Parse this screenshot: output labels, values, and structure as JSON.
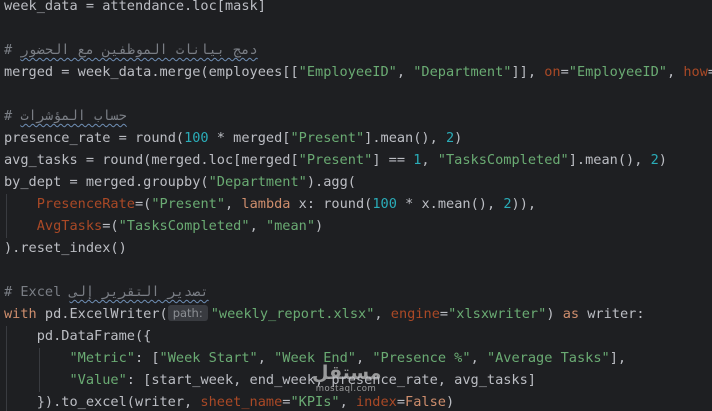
{
  "colors": {
    "background": "#1e1f22",
    "default_text": "#bcbec4",
    "keyword": "#cf8e6d",
    "string": "#6aab73",
    "number": "#2aacb8",
    "comment": "#7a7e85",
    "named_argument": "#aa4926",
    "hint_background": "#393b40"
  },
  "code": {
    "lines": [
      [
        [
          "default",
          "week_data = attendance.loc[mask]"
        ]
      ],
      [],
      [
        [
          "cmt",
          "# "
        ],
        [
          "cmt",
          "دمج بيانات الموظفين مع الحضور",
          "squig"
        ]
      ],
      [
        [
          "default",
          "merged = week_data.merge(employees[["
        ],
        [
          "str",
          "\"EmployeeID\""
        ],
        [
          "default",
          ", "
        ],
        [
          "str",
          "\"Department\""
        ],
        [
          "default",
          "]], "
        ],
        [
          "param",
          "on"
        ],
        [
          "default",
          "="
        ],
        [
          "str",
          "\"EmployeeID\""
        ],
        [
          "default",
          ", "
        ],
        [
          "param",
          "how"
        ],
        [
          "default",
          "="
        ],
        [
          "str",
          "\"l"
        ]
      ],
      [],
      [
        [
          "cmt",
          "# "
        ],
        [
          "cmt",
          "حساب المؤشرات",
          "squig"
        ]
      ],
      [
        [
          "default",
          "presence_rate = "
        ],
        [
          "default",
          "round"
        ],
        [
          "default",
          "("
        ],
        [
          "num",
          "100"
        ],
        [
          "default",
          " * merged["
        ],
        [
          "str",
          "\"Present\""
        ],
        [
          "default",
          "].mean(), "
        ],
        [
          "num",
          "2"
        ],
        [
          "default",
          ")"
        ]
      ],
      [
        [
          "default",
          "avg_tasks = "
        ],
        [
          "default",
          "round"
        ],
        [
          "default",
          "(merged.loc[merged["
        ],
        [
          "str",
          "\"Present\""
        ],
        [
          "default",
          "] == "
        ],
        [
          "num",
          "1"
        ],
        [
          "default",
          ", "
        ],
        [
          "str",
          "\"TasksCompleted\""
        ],
        [
          "default",
          "].mean(), "
        ],
        [
          "num",
          "2"
        ],
        [
          "default",
          ")"
        ]
      ],
      [
        [
          "default",
          "by_dept = merged.groupby("
        ],
        [
          "str",
          "\"Department\""
        ],
        [
          "default",
          ").agg("
        ]
      ],
      [
        [
          "default",
          "    "
        ],
        [
          "param",
          "PresenceRate"
        ],
        [
          "default",
          "=("
        ],
        [
          "str",
          "\"Present\""
        ],
        [
          "default",
          ", "
        ],
        [
          "kw",
          "lambda"
        ],
        [
          "default",
          " x: "
        ],
        [
          "default",
          "round"
        ],
        [
          "default",
          "("
        ],
        [
          "num",
          "100"
        ],
        [
          "default",
          " * x.mean(), "
        ],
        [
          "num",
          "2"
        ],
        [
          "default",
          ")),"
        ]
      ],
      [
        [
          "default",
          "    "
        ],
        [
          "param",
          "AvgTasks"
        ],
        [
          "default",
          "=("
        ],
        [
          "str",
          "\"TasksCompleted\""
        ],
        [
          "default",
          ", "
        ],
        [
          "str",
          "\"mean\""
        ],
        [
          "default",
          ")"
        ]
      ],
      [
        [
          "default",
          ").reset_index()"
        ]
      ],
      [],
      [
        [
          "cmt",
          "# Excel "
        ],
        [
          "cmt",
          "تصدير التقرير إلى",
          "squig"
        ]
      ],
      [
        [
          "kw",
          "with"
        ],
        [
          "default",
          " pd.ExcelWriter("
        ],
        [
          "hint",
          "path:"
        ],
        [
          "str",
          "\"weekly_report.xlsx\""
        ],
        [
          "default",
          ", "
        ],
        [
          "param",
          "engine"
        ],
        [
          "default",
          "="
        ],
        [
          "str",
          "\"xlsxwriter\""
        ],
        [
          "default",
          ") "
        ],
        [
          "kw",
          "as"
        ],
        [
          "default",
          " writer:"
        ]
      ],
      [
        [
          "default",
          "    pd.DataFrame({"
        ]
      ],
      [
        [
          "default",
          "        "
        ],
        [
          "str",
          "\"Metric\""
        ],
        [
          "default",
          ": ["
        ],
        [
          "str",
          "\"Week Start\""
        ],
        [
          "default",
          ", "
        ],
        [
          "str",
          "\"Week End\""
        ],
        [
          "default",
          ", "
        ],
        [
          "str",
          "\"Presence %\""
        ],
        [
          "default",
          ", "
        ],
        [
          "str",
          "\"Average Tasks\""
        ],
        [
          "default",
          "],"
        ]
      ],
      [
        [
          "default",
          "        "
        ],
        [
          "str",
          "\"Value\""
        ],
        [
          "default",
          ": [start_week, end_week, presence_rate, avg_tasks]"
        ]
      ],
      [
        [
          "default",
          "    }).to_excel(writer, "
        ],
        [
          "param",
          "sheet_name"
        ],
        [
          "default",
          "="
        ],
        [
          "str",
          "\"KPIs\""
        ],
        [
          "default",
          ", "
        ],
        [
          "param",
          "index"
        ],
        [
          "default",
          "="
        ],
        [
          "kw",
          "False"
        ],
        [
          "default",
          ")"
        ]
      ]
    ]
  },
  "watermark": {
    "logo": "مستقل",
    "text": "mostaql.com"
  }
}
